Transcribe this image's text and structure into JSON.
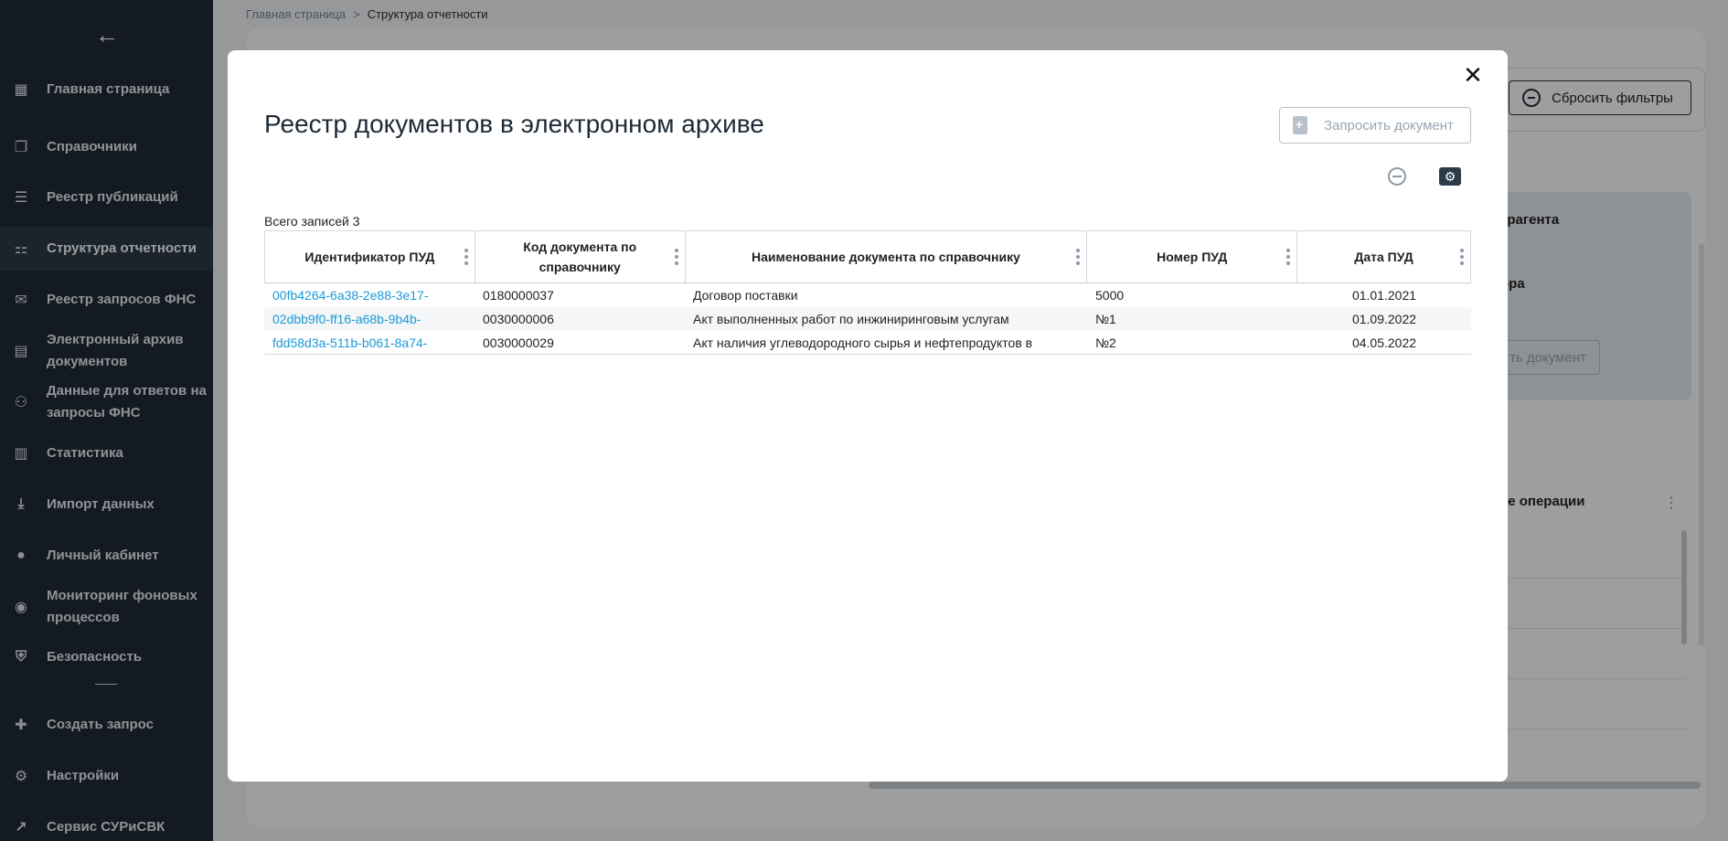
{
  "sidebar": {
    "items": [
      {
        "label": "Главная страница",
        "icon": "grid-icon"
      },
      {
        "label": "Справочники",
        "icon": "books-icon"
      },
      {
        "label": "Реестр публикаций",
        "icon": "list-icon"
      },
      {
        "label": "Структура отчетности",
        "icon": "structure-icon"
      },
      {
        "label": "Реестр запросов ФНС",
        "icon": "message-icon"
      },
      {
        "label": "Электронный архив документов",
        "icon": "archive-icon"
      },
      {
        "label": "Данные для ответов на запросы ФНС",
        "icon": "data-icon"
      },
      {
        "label": "Статистика",
        "icon": "chart-icon"
      },
      {
        "label": "Импорт данных",
        "icon": "import-icon"
      },
      {
        "label": "Личный кабинет",
        "icon": "user-icon"
      },
      {
        "label": "Мониторинг фоновых процессов",
        "icon": "eye-icon"
      },
      {
        "label": "Безопасность",
        "icon": "shield-icon"
      },
      {
        "label": "Создать запрос",
        "icon": "add-request-icon"
      },
      {
        "label": "Настройки",
        "icon": "gear-icon"
      },
      {
        "label": "Сервис СУРиСВК",
        "icon": "external-link-icon"
      }
    ]
  },
  "breadcrumb": {
    "home": "Главная страница",
    "separator": ">",
    "current": "Структура отчетности"
  },
  "background": {
    "reset_filters": "Сбросить фильтры",
    "panel_text1": "трагента",
    "panel_text2": "ора",
    "panel_button": "ть документ",
    "column_header": "ие операции"
  },
  "modal": {
    "title": "Реестр документов в электронном архиве",
    "request_button": "Запросить документ",
    "total": "Всего записей 3",
    "columns": [
      "Идентификатор ПУД",
      "Код документа по справочнику",
      "Наименование документа по справочнику",
      "Номер ПУД",
      "Дата ПУД"
    ],
    "rows": [
      [
        "00fb4264-6a38-2e88-3e17-",
        "0180000037",
        "Договор поставки",
        "5000",
        "01.01.2021"
      ],
      [
        "02dbb9f0-ff16-a68b-9b4b-",
        "0030000006",
        "Акт выполненных работ по инжиниринговым услугам",
        "№1",
        "01.09.2022"
      ],
      [
        "fdd58d3a-511b-b061-8a74-",
        "0030000029",
        "Акт наличия углеводородного сырья и нефтепродуктов в",
        "№2",
        "04.05.2022"
      ]
    ]
  },
  "colors": {
    "sidebar_bg": "#1f2a36",
    "link": "#1a9ad6",
    "accent_dark": "#2d3a4a"
  }
}
